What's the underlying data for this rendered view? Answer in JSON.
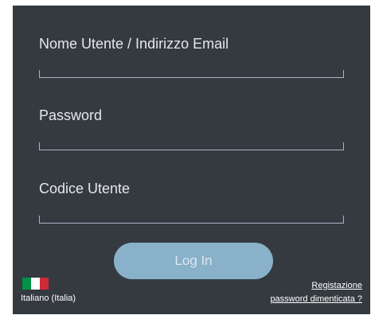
{
  "form": {
    "username": {
      "label": "Nome Utente / Indirizzo Email",
      "value": ""
    },
    "password": {
      "label": "Password",
      "value": ""
    },
    "user_code": {
      "label": "Codice Utente",
      "value": ""
    },
    "login_label": "Log In"
  },
  "footer": {
    "language_label": "Italiano (Italia)",
    "flag_colors": [
      "#009246",
      "#ffffff",
      "#ce2b37"
    ],
    "register_link": "Registazione",
    "forgot_password_link": "password dimenticata ?"
  },
  "colors": {
    "panel_background": "#343a40",
    "button_background": "#8ab1ca",
    "input_underline": "#a8b6c6"
  }
}
